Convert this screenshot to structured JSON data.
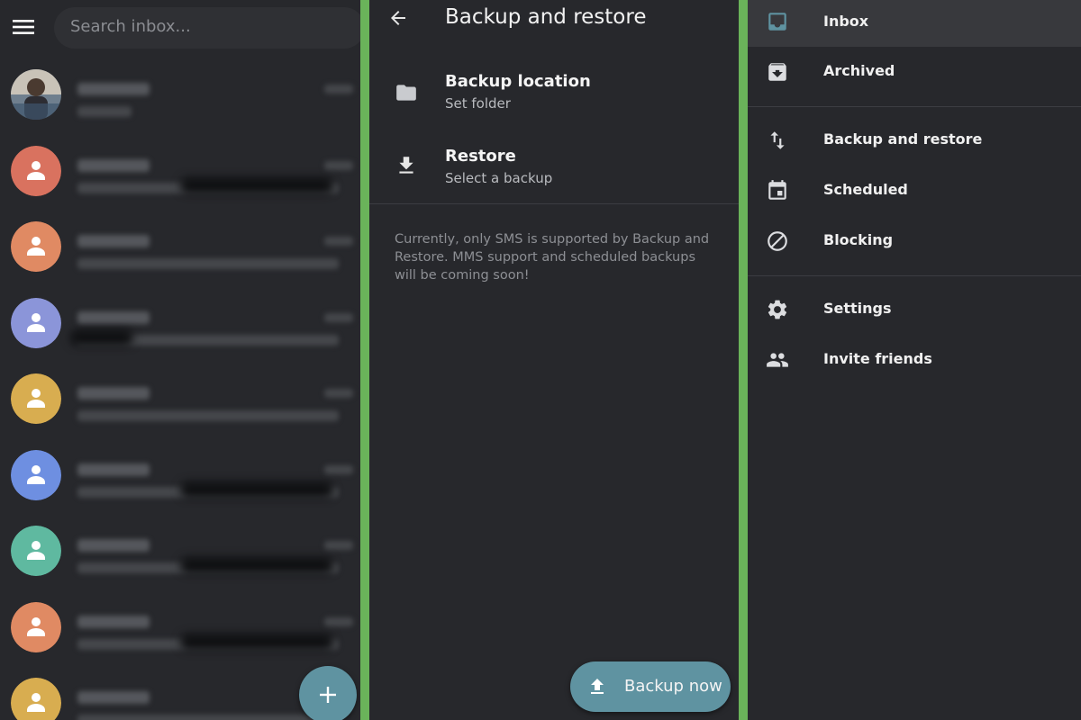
{
  "inbox": {
    "search_placeholder": "Search inbox...",
    "avatar_colors": [
      "#d9725f",
      "#e08a63",
      "#8b95d9",
      "#d8ad50",
      "#6e8fe1",
      "#5fb9a0",
      "#e08a63",
      "#d8ad50"
    ]
  },
  "backup": {
    "title": "Backup and restore",
    "location_label": "Backup location",
    "location_sub": "Set folder",
    "restore_label": "Restore",
    "restore_sub": "Select a backup",
    "note": "Currently, only SMS is supported by Backup and Restore. MMS support and scheduled backups will be coming soon!",
    "backup_now_label": "Backup now"
  },
  "drawer": {
    "inbox": "Inbox",
    "archived": "Archived",
    "backup_restore": "Backup and restore",
    "scheduled": "Scheduled",
    "blocking": "Blocking",
    "settings": "Settings",
    "invite_friends": "Invite friends"
  },
  "colors": {
    "accent": "#5f93a1",
    "background": "#27282c",
    "divider": "#6ab35a"
  }
}
